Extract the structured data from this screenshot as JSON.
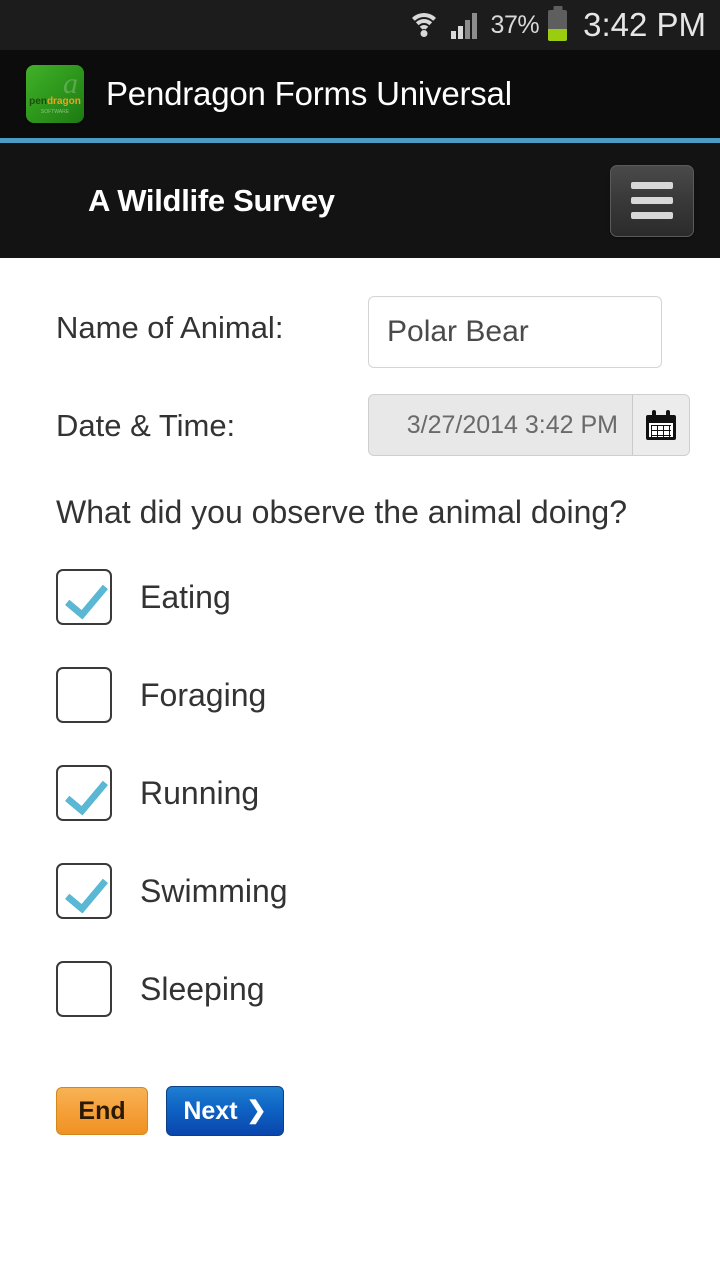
{
  "status_bar": {
    "wifi_icon": "wifi-icon",
    "signal_icon": "cellular-signal-icon",
    "battery_percent": "37%",
    "battery_icon": "battery-icon",
    "time": "3:42 PM"
  },
  "app_bar": {
    "logo_icon": "pendragon-logo-icon",
    "logo_word_a": "pen",
    "logo_word_b": "dragon",
    "logo_subtitle": "SOFTWARE",
    "logo_swirl": "a",
    "title": "Pendragon Forms Universal",
    "accent_color": "#4b9cc4"
  },
  "form_header": {
    "title": "A Wildlife Survey",
    "menu_icon": "hamburger-menu-icon"
  },
  "form": {
    "name_field": {
      "label": "Name of Animal:",
      "value": "Polar Bear",
      "placeholder": ""
    },
    "date_field": {
      "label": "Date & Time:",
      "value": "3/27/2014 3:42 PM",
      "calendar_icon": "calendar-icon"
    },
    "question": "What did you observe the animal doing?",
    "options": [
      {
        "label": "Eating",
        "checked": true
      },
      {
        "label": "Foraging",
        "checked": false
      },
      {
        "label": "Running",
        "checked": true
      },
      {
        "label": "Swimming",
        "checked": true
      },
      {
        "label": "Sleeping",
        "checked": false
      }
    ],
    "checkmark_color": "#5bb8d4"
  },
  "buttons": {
    "end_label": "End",
    "next_label": "Next",
    "next_chevron": "❯",
    "end_color": "#f5a03a",
    "next_color": "#0e63c4"
  }
}
